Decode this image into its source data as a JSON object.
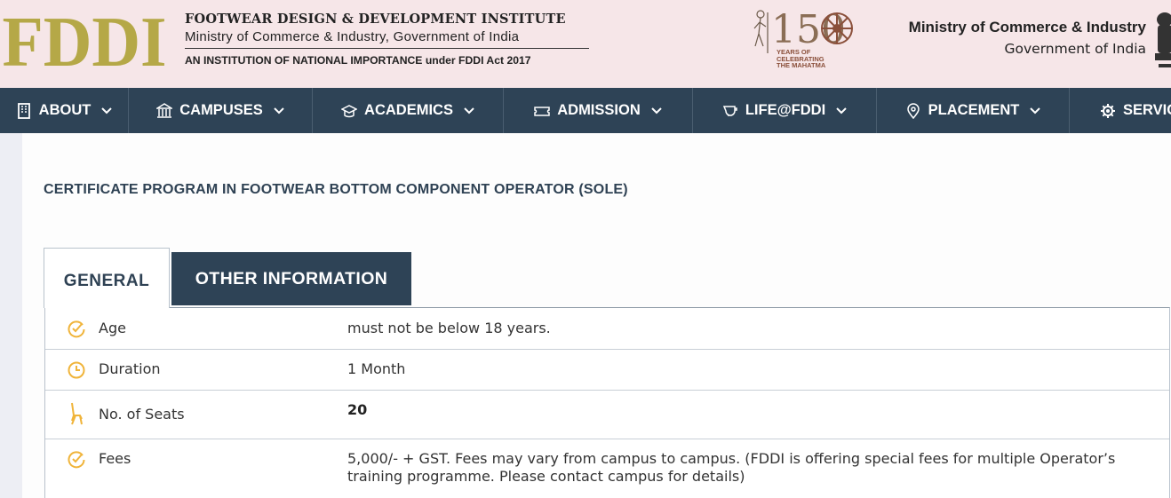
{
  "header": {
    "logo_text": "FDDI",
    "institute_name": "FOOTWEAR DESIGN & DEVELOPMENT INSTITUTE",
    "institute_ministry": "Ministry of Commerce & Industry, Government of India",
    "institute_status": "AN INSTITUTION OF NATIONAL IMPORTANCE under FDDI Act 2017",
    "gandhi_badge": {
      "number": "150",
      "caption_lines": [
        "YEARS OF",
        "CELEBRATING",
        "THE MAHATMA"
      ]
    },
    "ministry_title": "Ministry of Commerce & Industry",
    "ministry_sub": "Government of India"
  },
  "nav": {
    "items": [
      {
        "label": "ABOUT",
        "icon": "building-icon"
      },
      {
        "label": "CAMPUSES",
        "icon": "institution-icon"
      },
      {
        "label": "ACADEMICS",
        "icon": "graduation-cap-icon"
      },
      {
        "label": "ADMISSION",
        "icon": "ticket-icon"
      },
      {
        "label": "LIFE@FDDI",
        "icon": "cup-icon"
      },
      {
        "label": "PLACEMENT",
        "icon": "location-pin-icon"
      },
      {
        "label": "SERVIC",
        "icon": "gear-icon"
      }
    ]
  },
  "page": {
    "title": "CERTIFICATE PROGRAM IN FOOTWEAR BOTTOM COMPONENT OPERATOR (SOLE)"
  },
  "tabs": {
    "general": "GENERAL",
    "other": "OTHER INFORMATION",
    "active": "GENERAL"
  },
  "info": {
    "rows": [
      {
        "label": "Age",
        "value": "must not be below 18 years.",
        "icon": "check-circle-icon"
      },
      {
        "label": "Duration",
        "value": "1 Month",
        "icon": "clock-icon"
      },
      {
        "label": "No. of Seats",
        "value": "20",
        "icon": "seat-icon"
      },
      {
        "label": "Fees",
        "value": "5,000/- + GST. Fees may vary from campus to campus. (FDDI is offering special fees for multiple Operator’s training programme. Please contact campus for details)",
        "icon": "check-circle-icon"
      }
    ]
  },
  "colors": {
    "header_bg": "#f6e6e8",
    "nav_bg": "#2e4356",
    "logo": "#b5a847",
    "icon_accent": "#f0b43a",
    "title_text": "#2f4254"
  }
}
